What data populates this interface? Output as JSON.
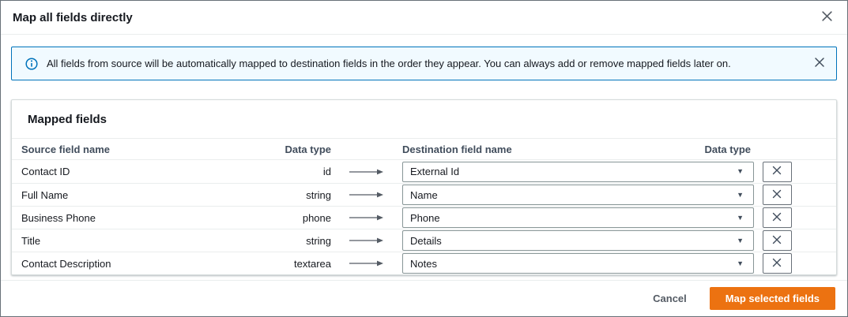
{
  "modal": {
    "title": "Map all fields directly"
  },
  "alert": {
    "text": "All fields from source will be automatically mapped to destination fields in the order they appear. You can always add or remove mapped fields later on."
  },
  "section": {
    "title": "Mapped fields"
  },
  "table": {
    "headers": {
      "source_name": "Source field name",
      "source_type": "Data type",
      "dest_name": "Destination field name",
      "dest_type": "Data type"
    },
    "rows": [
      {
        "source": "Contact ID",
        "type": "id",
        "destination": "External Id"
      },
      {
        "source": "Full Name",
        "type": "string",
        "destination": "Name"
      },
      {
        "source": "Business Phone",
        "type": "phone",
        "destination": "Phone"
      },
      {
        "source": "Title",
        "type": "string",
        "destination": "Details"
      },
      {
        "source": "Contact Description",
        "type": "textarea",
        "destination": "Notes"
      }
    ]
  },
  "footer": {
    "cancel_label": "Cancel",
    "submit_label": "Map selected fields"
  },
  "icons": {
    "dropdown_caret": "▼"
  },
  "colors": {
    "accent": "#ec7211",
    "alert_border": "#0073bb",
    "alert_background": "#f1faff"
  }
}
